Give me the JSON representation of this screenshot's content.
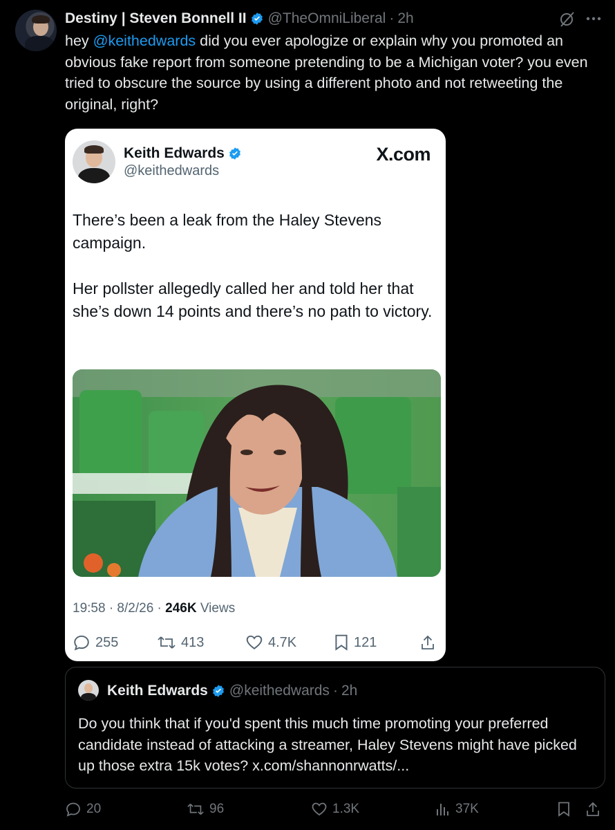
{
  "author": {
    "display_name": "Destiny | Steven Bonnell II",
    "handle": "@TheOmniLiberal",
    "time": "2h"
  },
  "tweet": {
    "text_prefix": "hey ",
    "mention": "@keithedwards",
    "text_rest": " did you ever apologize or explain why you promoted an obvious fake report from someone pretending to be a Michigan voter? you even tried to obscure the source by using a different photo and not retweeting the original, right?"
  },
  "embedded_card": {
    "name": "Keith Edwards",
    "handle": "@keithedwards",
    "site": "X.com",
    "paragraph_1": "There’s been a leak from the Haley Stevens campaign.",
    "paragraph_2": "Her pollster allegedly called her and told her that she’s down 14 points and there’s no path to victory.",
    "timestamp": "19:58 · 8/2/26 · ",
    "views_count": "246K",
    "views_label": " Views",
    "replies": "255",
    "reposts": "413",
    "likes": "4.7K",
    "bookmarks": "121"
  },
  "quote": {
    "name": "Keith Edwards",
    "handle": "@keithedwards",
    "time": "2h",
    "text": "Do you think that if you'd spent this much time promoting your preferred candidate instead of attacking a streamer, Haley Stevens might have picked up those extra 15k votes? x.com/shannonrwatts/..."
  },
  "actions": {
    "replies": "20",
    "reposts": "96",
    "likes": "1.3K",
    "views": "37K"
  },
  "colors": {
    "background": "#000000",
    "text": "#e7e9ea",
    "muted": "#71767b",
    "accent": "#1d9bf0",
    "card_bg": "#ffffff"
  }
}
